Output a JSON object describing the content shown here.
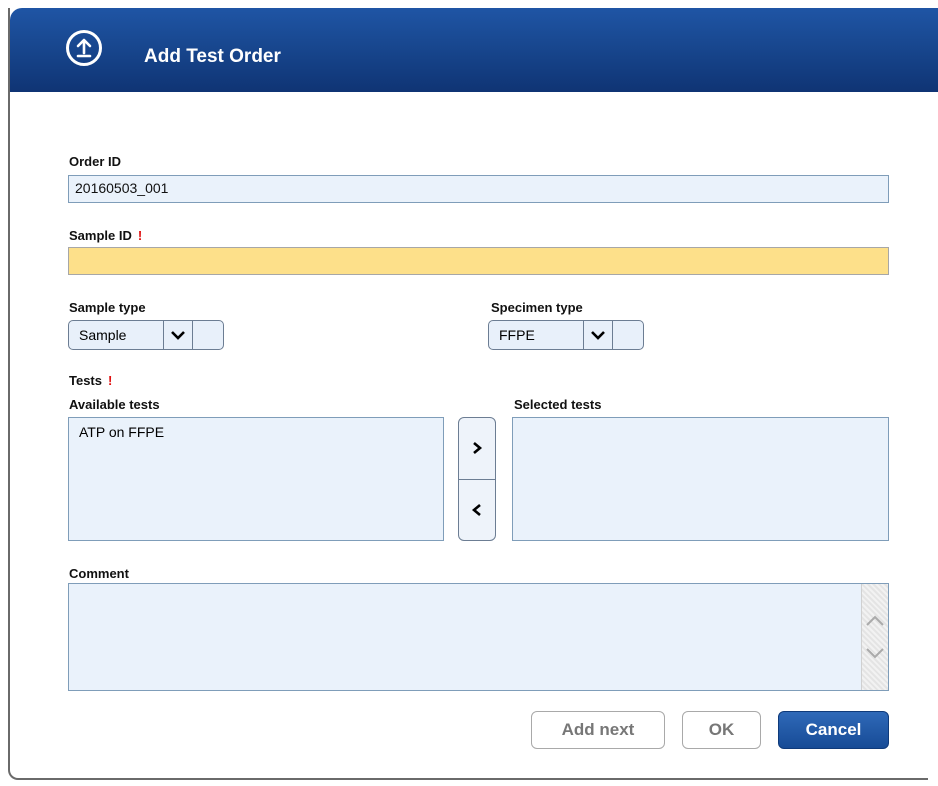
{
  "header": {
    "title": "Add Test Order",
    "icon": "upload-circle-icon"
  },
  "order_id": {
    "label": "Order ID",
    "value": "20160503_001"
  },
  "sample_id": {
    "label": "Sample ID",
    "required_mark": "!",
    "value": ""
  },
  "sample_type": {
    "label": "Sample type",
    "value": "Sample"
  },
  "specimen_type": {
    "label": "Specimen type",
    "value": "FFPE"
  },
  "tests": {
    "label": "Tests",
    "required_mark": "!",
    "available_label": "Available tests",
    "selected_label": "Selected tests",
    "available": [
      "ATP on FFPE"
    ],
    "selected": [],
    "move_right": ">",
    "move_left": "<"
  },
  "comment": {
    "label": "Comment",
    "value": ""
  },
  "buttons": {
    "add_next": "Add next",
    "ok": "OK",
    "cancel": "Cancel"
  },
  "colors": {
    "header": "#18478f",
    "required_field": "#fde08a",
    "field": "#eaf2fb",
    "required_mark": "#e01010"
  }
}
